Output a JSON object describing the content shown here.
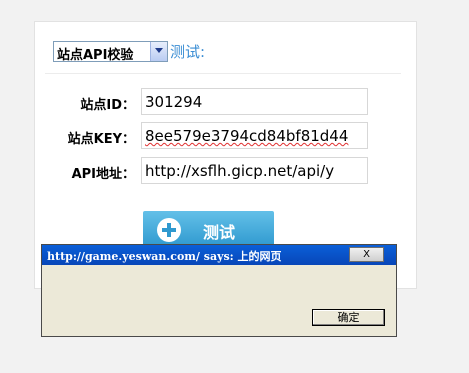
{
  "form": {
    "select_value": "站点API校验",
    "test_title": "测试:",
    "rows": [
      {
        "label": "站点ID：",
        "value": "301294"
      },
      {
        "label": "站点KEY：",
        "value": "8ee579e3794cd84bf81d44"
      },
      {
        "label": "API地址：",
        "value": "http://xsflh.gicp.net/api/y"
      }
    ],
    "test_button": "测试"
  },
  "dialog": {
    "title": "http://game.yeswan.com/ says: 上的网页",
    "close_label": "X",
    "ok_label": "确定"
  },
  "colors": {
    "accent": "#3b8ed4",
    "button": "#2f99cf",
    "dialog_title_bar": "#0a5fd8"
  },
  "icons": {
    "select_arrow": "chevron-down-icon",
    "button_icon": "plus-circle-icon"
  }
}
